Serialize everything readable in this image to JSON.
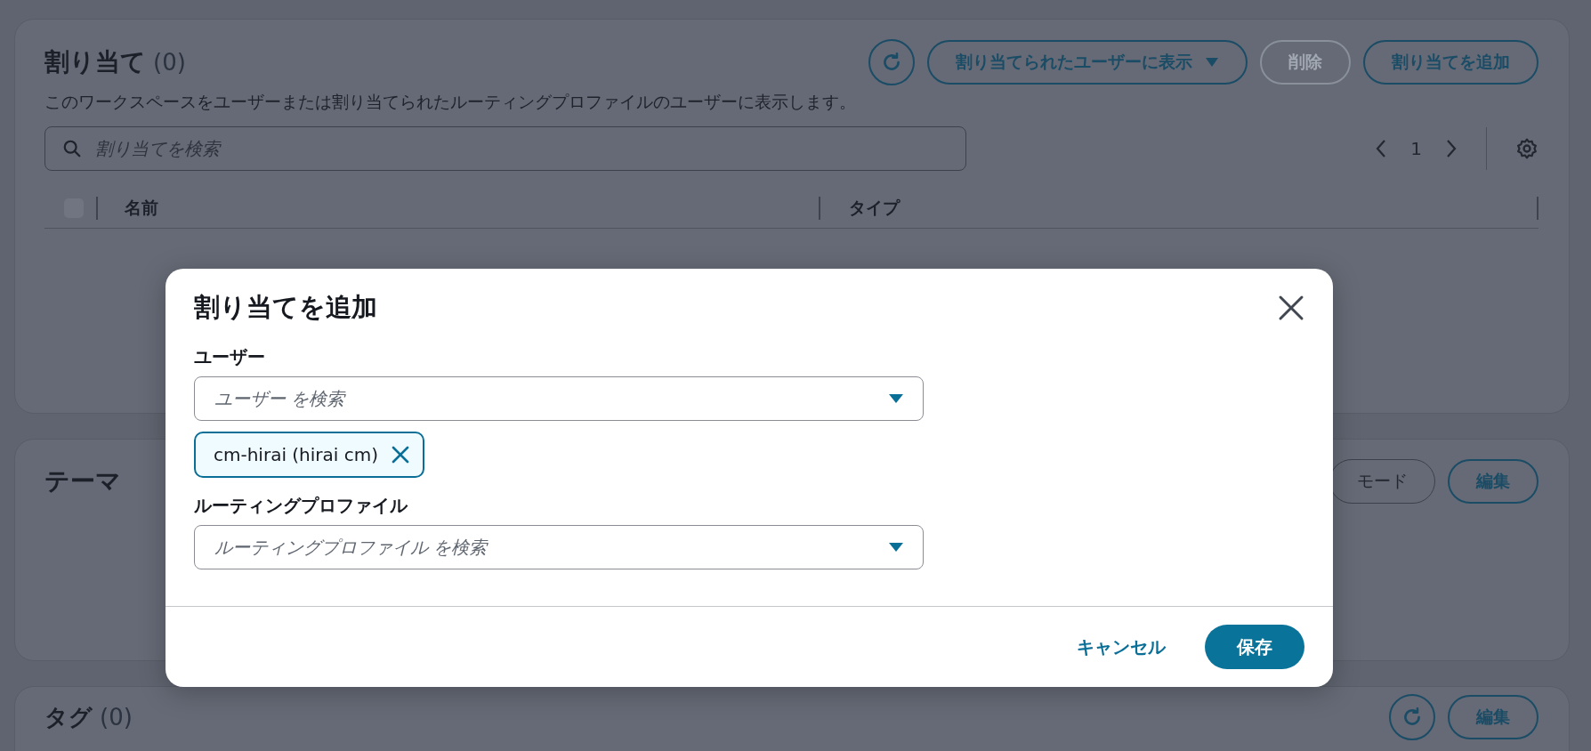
{
  "assignments": {
    "title": "割り当て",
    "count": "(0)",
    "description": "このワークスペースをユーザーまたは割り当てられたルーティングプロファイルのユーザーに表示します。",
    "buttons": [
      {
        "kind": "refresh",
        "disabled": false
      },
      {
        "kind": "dropdown",
        "label": "割り当てられたユーザーに表示",
        "disabled": false
      },
      {
        "kind": "text",
        "label": "削除",
        "disabled": true
      },
      {
        "kind": "text",
        "label": "割り当てを追加",
        "disabled": false
      }
    ],
    "search": {
      "placeholder": "割り当てを検索"
    },
    "pagination": {
      "page": "1"
    },
    "table": {
      "select_all": {
        "checked": false,
        "disabled": true
      },
      "columns": [
        "名前",
        "タイプ"
      ]
    }
  },
  "theme": {
    "title": "テーマ",
    "buttons": [
      {
        "kind": "normal",
        "label": "モード",
        "disabled": false
      },
      {
        "kind": "text",
        "label": "編集",
        "disabled": false
      }
    ]
  },
  "tags": {
    "title": "タグ",
    "count": "(0)",
    "buttons": [
      {
        "kind": "refresh",
        "disabled": false
      },
      {
        "kind": "text",
        "label": "編集",
        "disabled": false
      }
    ]
  },
  "modal": {
    "title": "割り当てを追加",
    "fields": [
      {
        "label": "ユーザー",
        "placeholder": "ユーザー を検索",
        "tokens": [
          "cm-hirai (hirai cm)"
        ]
      },
      {
        "label": "ルーティングプロファイル",
        "placeholder": "ルーティングプロファイル を検索"
      }
    ],
    "buttons": [
      {
        "kind": "link",
        "label": "キャンセル"
      },
      {
        "kind": "primary",
        "label": "保存"
      }
    ]
  }
}
